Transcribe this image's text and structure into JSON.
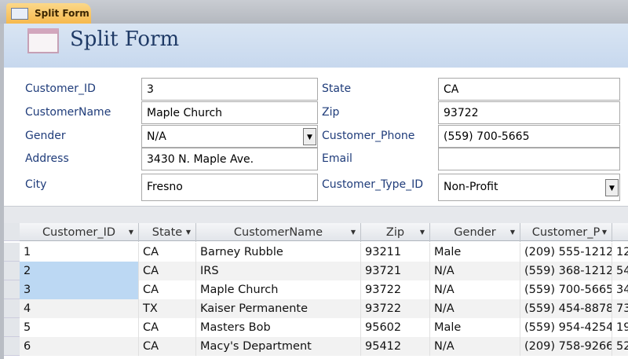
{
  "tab": {
    "label": "Split Form",
    "icon": "form-icon"
  },
  "header": {
    "title": "Split Form",
    "icon": "form-icon"
  },
  "form": {
    "customer_id": {
      "label": "Customer_ID",
      "value": "3"
    },
    "customer_name": {
      "label": "CustomerName",
      "value": "Maple Church"
    },
    "gender": {
      "label": "Gender",
      "value": "N/A"
    },
    "address": {
      "label": "Address",
      "value": "3430 N. Maple Ave."
    },
    "city": {
      "label": "City",
      "value": "Fresno"
    },
    "state": {
      "label": "State",
      "value": "CA"
    },
    "zip": {
      "label": "Zip",
      "value": "93722"
    },
    "phone": {
      "label": "Customer_Phone",
      "value": "(559) 700-5665"
    },
    "email": {
      "label": "Email",
      "value": ""
    },
    "type": {
      "label": "Customer_Type_ID",
      "value": "Non-Profit"
    }
  },
  "datasheet": {
    "columns": [
      "Customer_ID",
      "State",
      "CustomerName",
      "Zip",
      "Gender",
      "Customer_P",
      ""
    ],
    "rows": [
      [
        "1",
        "CA",
        "Barney Rubble",
        "93211",
        "Male",
        "(209) 555-1212",
        "12"
      ],
      [
        "2",
        "CA",
        "IRS",
        "93721",
        "N/A",
        "(559) 368-1212",
        "54"
      ],
      [
        "3",
        "CA",
        "Maple Church",
        "93722",
        "N/A",
        "(559) 700-5665",
        "34"
      ],
      [
        "4",
        "TX",
        "Kaiser Permanente",
        "93722",
        "N/A",
        "(559) 454-8878",
        "73"
      ],
      [
        "5",
        "CA",
        "Masters Bob",
        "95602",
        "Male",
        "(559) 954-4254",
        "19"
      ],
      [
        "6",
        "CA",
        "Macy's Department",
        "95412",
        "N/A",
        "(209) 758-9266",
        "52"
      ]
    ]
  }
}
